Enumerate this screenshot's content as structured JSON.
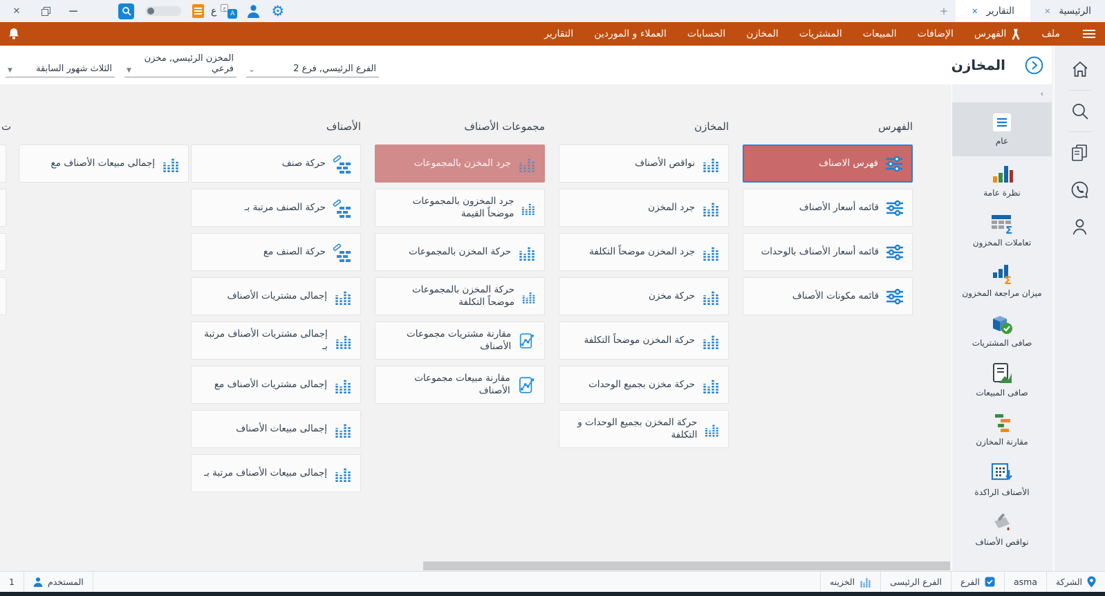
{
  "titlebar": {
    "tabs": [
      {
        "label": "الرئيسية",
        "active": false
      },
      {
        "label": "التقارير",
        "active": true
      }
    ],
    "new_tab_label": "+",
    "close_glyph": "✕",
    "minimize_glyph": "—",
    "lang_letter": "ع",
    "translate_badge": "A",
    "gear_glyph": "⚙"
  },
  "menubar": {
    "items": [
      "ملف",
      "الفهرس",
      "الإضافات",
      "المبيعات",
      "المشتريات",
      "المخازن",
      "الحسابات",
      "العملاء و الموردين",
      "التقارير"
    ]
  },
  "toolbar": {
    "title": "المخازن",
    "filters": [
      {
        "value": "الفرع الرئيسي, فرع 2"
      },
      {
        "value": "المخزن الرئيسي, مخزن فرعي"
      },
      {
        "value": "الثلاث شهور السابقة"
      }
    ],
    "collapse_glyph": "›"
  },
  "sidebar": {
    "items": [
      {
        "label": "عام",
        "selected": true
      },
      {
        "label": "نظرة عامة"
      },
      {
        "label": "تعاملات المخزون"
      },
      {
        "label": "ميزان مراجعة المخزون"
      },
      {
        "label": "صافى المشتريات"
      },
      {
        "label": "صافى المبيعات"
      },
      {
        "label": "مقارنة المخازن"
      },
      {
        "label": "الأصناف الراكدة"
      },
      {
        "label": "نواقص الأصناف"
      }
    ]
  },
  "content": {
    "partial_header": "ت",
    "columns": [
      {
        "header": "الفهرس",
        "cards": [
          {
            "label": "فهرس الاصناف",
            "icon": "sliders-icon",
            "state": "selected"
          },
          {
            "label": "قائمه أسعار الأصناف",
            "icon": "sliders-icon"
          },
          {
            "label": "قائمه أسعار الأصناف بالوحدات",
            "icon": "sliders-icon"
          },
          {
            "label": "قائمه مكونات الأصناف",
            "icon": "sliders-icon"
          }
        ]
      },
      {
        "header": "المخازن",
        "cards": [
          {
            "label": "نواقص الأصناف",
            "icon": "equalizer-icon"
          },
          {
            "label": "جرد المخزن",
            "icon": "equalizer-icon"
          },
          {
            "label": "جرد المخزن موضحاً التكلفة",
            "icon": "equalizer-icon"
          },
          {
            "label": "حركة مخزن",
            "icon": "equalizer-icon"
          },
          {
            "label": "حركة المخزن موضحاً التكلفة",
            "icon": "equalizer-icon"
          },
          {
            "label": "حركة مخزن بجميع الوحدات",
            "icon": "equalizer-icon"
          },
          {
            "label": "حركة المخزن بجميع الوحدات و التكلفة",
            "icon": "equalizer-icon"
          }
        ]
      },
      {
        "header": "مجموعات الأصناف",
        "cards": [
          {
            "label": "جرد المخزن بالمجموعات",
            "icon": "equalizer-icon",
            "state": "highlighted"
          },
          {
            "label": "جرد المخزون بالمجموعات موضحاً القيمة",
            "icon": "equalizer-icon"
          },
          {
            "label": "حركة المخزن بالمجموعات",
            "icon": "equalizer-icon"
          },
          {
            "label": "حركة المخزن بالمجموعات موضحاً التكلفة",
            "icon": "equalizer-icon"
          },
          {
            "label": "مقارنة مشتريات مجموعات الأصناف",
            "icon": "line-chart-icon"
          },
          {
            "label": "مقارنة مبيعات مجموعات الأصناف",
            "icon": "line-chart-icon"
          }
        ]
      },
      {
        "header": "الأصناف",
        "cards": [
          {
            "label": "حركة صنف",
            "icon": "bricks-icon"
          },
          {
            "label": "حركة الصنف مرتبة بـ",
            "icon": "bricks-icon"
          },
          {
            "label": "حركة الصنف مع",
            "icon": "bricks-icon"
          },
          {
            "label": "إجمالى مشتريات الأصناف",
            "icon": "equalizer-icon"
          },
          {
            "label": "إجمالى مشتريات الأصناف مرتبة بـ",
            "icon": "equalizer-icon"
          },
          {
            "label": "إجمالى مشتريات الأصناف مع",
            "icon": "equalizer-icon"
          },
          {
            "label": "إجمالى مبيعات الأصناف",
            "icon": "equalizer-icon"
          },
          {
            "label": "إجمالى مبيعات الأصناف مرتبة بـ",
            "icon": "equalizer-icon"
          }
        ]
      },
      {
        "header": "",
        "cards": [
          {
            "label": "إجمالى مبيعات الأصناف مع",
            "icon": "equalizer-icon"
          }
        ]
      }
    ]
  },
  "statusbar": {
    "left": [
      {
        "label": "1"
      },
      {
        "label": "المستخدم",
        "icon": "user-icon"
      }
    ],
    "right": [
      {
        "label": "الشركة",
        "icon": "map-pin-icon"
      },
      {
        "label": "asma"
      },
      {
        "label": "الفرع",
        "icon": "checkbox-icon"
      },
      {
        "label": "الفرع الرئيسى"
      },
      {
        "label": "الخزينه",
        "icon": "equalizer-icon"
      }
    ]
  },
  "colors": {
    "accent_blue": "#1a7fd4",
    "menubar_orange": "#c04e10",
    "selected_card_red": "#c96969",
    "highlighted_card_red": "#d18b8b",
    "selected_card_border": "#2a80d0",
    "dark_text": "#2b3947",
    "sidebar_bg": "#eef0f3",
    "content_bg": "#f2f2f2",
    "bottom_strip": "#17222d"
  }
}
